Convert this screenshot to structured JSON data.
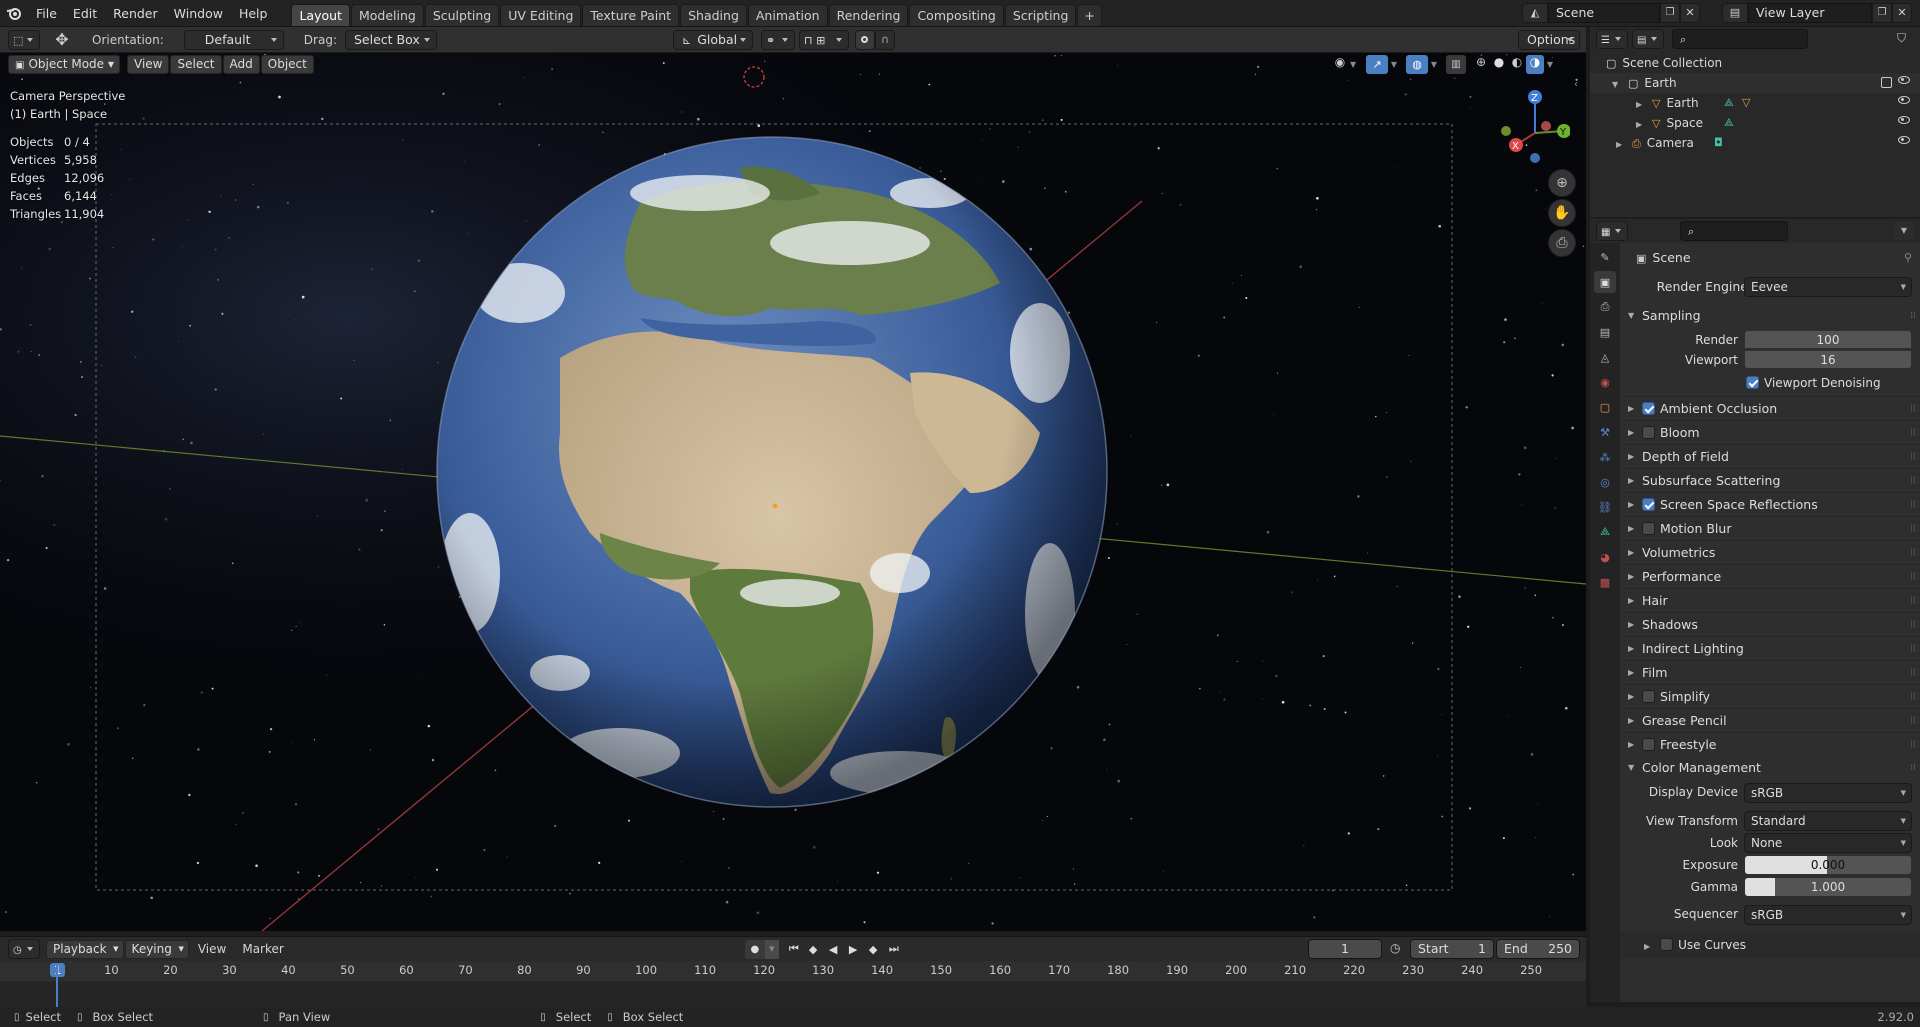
{
  "topbar": {
    "menus": [
      "File",
      "Edit",
      "Render",
      "Window",
      "Help"
    ],
    "workspaces": [
      "Layout",
      "Modeling",
      "Sculpting",
      "UV Editing",
      "Texture Paint",
      "Shading",
      "Animation",
      "Rendering",
      "Compositing",
      "Scripting"
    ],
    "active_workspace": "Layout",
    "add_tab": "+",
    "scene": "Scene",
    "view_layer": "View Layer"
  },
  "tool_header": {
    "orientation_label": "Orientation:",
    "orientation_value": "Default",
    "drag_label": "Drag:",
    "drag_value": "Select Box",
    "transform_orientation": "Global",
    "options": "Options"
  },
  "viewport_header": {
    "mode": "Object Mode",
    "menus": [
      "View",
      "Select",
      "Add",
      "Object"
    ]
  },
  "viewport": {
    "camera_label": "Camera Perspective",
    "context": "(1) Earth | Space",
    "stats": [
      {
        "label": "Objects",
        "value": "0 / 4"
      },
      {
        "label": "Vertices",
        "value": "5,958"
      },
      {
        "label": "Edges",
        "value": "12,096"
      },
      {
        "label": "Faces",
        "value": "6,144"
      },
      {
        "label": "Triangles",
        "value": "11,904"
      }
    ],
    "gizmo": {
      "x": "X",
      "y": "Y",
      "z": "Z"
    }
  },
  "timeline": {
    "menus": [
      "Playback",
      "Keying",
      "View",
      "Marker"
    ],
    "current_frame": "1",
    "start_label": "Start",
    "start": "1",
    "end_label": "End",
    "end": "250",
    "ticks": [
      "1",
      "10",
      "20",
      "30",
      "40",
      "50",
      "60",
      "70",
      "80",
      "90",
      "100",
      "110",
      "120",
      "130",
      "140",
      "150",
      "160",
      "170",
      "180",
      "190",
      "200",
      "210",
      "220",
      "230",
      "240",
      "250"
    ]
  },
  "statusbar": {
    "items": [
      "Select",
      "Box Select",
      "Pan View",
      "Select",
      "Box Select"
    ],
    "version": "2.92.0"
  },
  "outliner": {
    "root": "Scene Collection",
    "items": [
      {
        "name": "Earth",
        "level": 0,
        "type": "collection"
      },
      {
        "name": "Earth",
        "level": 1,
        "type": "mesh"
      },
      {
        "name": "Space",
        "level": 1,
        "type": "mesh"
      },
      {
        "name": "Camera",
        "level": 0,
        "type": "camera"
      }
    ]
  },
  "properties": {
    "scene_name": "Scene",
    "render_engine_label": "Render Engine",
    "render_engine": "Eevee",
    "sampling": {
      "title": "Sampling",
      "render_label": "Render",
      "render": "100",
      "viewport_label": "Viewport",
      "viewport": "16",
      "denoise_label": "Viewport Denoising",
      "denoise": true
    },
    "panels": [
      {
        "label": "Ambient Occlusion",
        "checkbox": true,
        "checked": true
      },
      {
        "label": "Bloom",
        "checkbox": true,
        "checked": false
      },
      {
        "label": "Depth of Field",
        "checkbox": false,
        "checked": false
      },
      {
        "label": "Subsurface Scattering",
        "checkbox": false,
        "checked": false
      },
      {
        "label": "Screen Space Reflections",
        "checkbox": true,
        "checked": true
      },
      {
        "label": "Motion Blur",
        "checkbox": true,
        "checked": false
      },
      {
        "label": "Volumetrics",
        "checkbox": false,
        "checked": false
      },
      {
        "label": "Performance",
        "checkbox": false,
        "checked": false
      },
      {
        "label": "Hair",
        "checkbox": false,
        "checked": false
      },
      {
        "label": "Shadows",
        "checkbox": false,
        "checked": false
      },
      {
        "label": "Indirect Lighting",
        "checkbox": false,
        "checked": false
      },
      {
        "label": "Film",
        "checkbox": false,
        "checked": false
      },
      {
        "label": "Simplify",
        "checkbox": true,
        "checked": false
      },
      {
        "label": "Grease Pencil",
        "checkbox": false,
        "checked": false
      },
      {
        "label": "Freestyle",
        "checkbox": true,
        "checked": false
      }
    ],
    "color_management": {
      "title": "Color Management",
      "display_device_label": "Display Device",
      "display_device": "sRGB",
      "view_transform_label": "View Transform",
      "view_transform": "Standard",
      "look_label": "Look",
      "look": "None",
      "exposure_label": "Exposure",
      "exposure": "0.000",
      "gamma_label": "Gamma",
      "gamma": "1.000",
      "sequencer_label": "Sequencer",
      "sequencer": "sRGB",
      "use_curves_label": "Use Curves"
    }
  },
  "colors": {
    "accent": "#4a7fc1",
    "active_tab": "#454545",
    "x_axis": "#a33a3a",
    "y_axis": "#6b8f2e",
    "z_axis": "#3f7fd6"
  }
}
